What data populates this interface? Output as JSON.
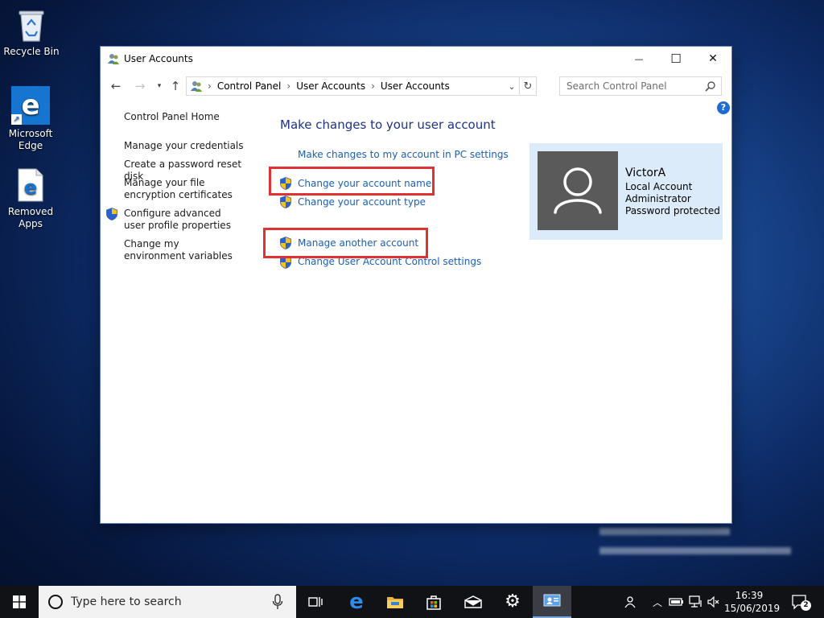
{
  "desktop": {
    "icons": [
      {
        "label": "Recycle Bin"
      },
      {
        "label": "Microsoft Edge"
      },
      {
        "label": "Removed Apps"
      }
    ]
  },
  "window": {
    "title": "User Accounts",
    "controls": {
      "minimize": "—",
      "maximize": "☐",
      "close": "✕"
    }
  },
  "address_bar": {
    "breadcrumbs": [
      "Control Panel",
      "User Accounts",
      "User Accounts"
    ],
    "search_placeholder": "Search Control Panel"
  },
  "left_nav": {
    "items": [
      "Control Panel Home",
      "Manage your credentials",
      "Create a password reset disk",
      "Manage your file encryption certificates",
      "Configure advanced user profile properties",
      "Change my environment variables"
    ]
  },
  "main": {
    "heading": "Make changes to your user account",
    "links": [
      "Make changes to my account in PC settings",
      "Change your account name",
      "Change your account type",
      "Manage another account",
      "Change User Account Control settings"
    ]
  },
  "account": {
    "name": "VictorA",
    "type": "Local Account",
    "role": "Administrator",
    "status": "Password protected"
  },
  "taskbar": {
    "search_placeholder": "Type here to search",
    "clock_time": "16:39",
    "clock_date": "15/06/2019",
    "notification_count": "2"
  },
  "colors": {
    "link": "#1a5fb4",
    "heading": "#1e3287",
    "highlight": "#e03232",
    "account_panel": "#dcebfa"
  }
}
